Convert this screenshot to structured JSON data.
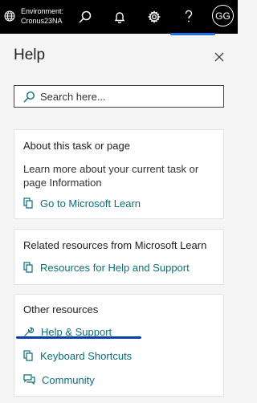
{
  "topbar": {
    "environment_label": "Environment:",
    "environment_name": "Cronus23NA",
    "avatar_initials": "GG",
    "icons": [
      "globe-icon",
      "search-icon",
      "bell-icon",
      "gear-icon",
      "help-icon"
    ]
  },
  "panel": {
    "title": "Help",
    "search_placeholder": "Search here..."
  },
  "cards": {
    "task": {
      "title": "About this task or page",
      "description": "Learn more about your current task or page Information",
      "link": "Go to Microsoft Learn"
    },
    "related": {
      "title": "Related resources from Microsoft Learn",
      "link": "Resources for Help and Support"
    },
    "other": {
      "title": "Other resources",
      "links": [
        "Help & Support",
        "Keyboard Shortcuts",
        "Community"
      ]
    }
  },
  "colors": {
    "topbar_bg": "#000000",
    "link": "#0c6e7a",
    "active_indicator": "#1a73e8"
  }
}
